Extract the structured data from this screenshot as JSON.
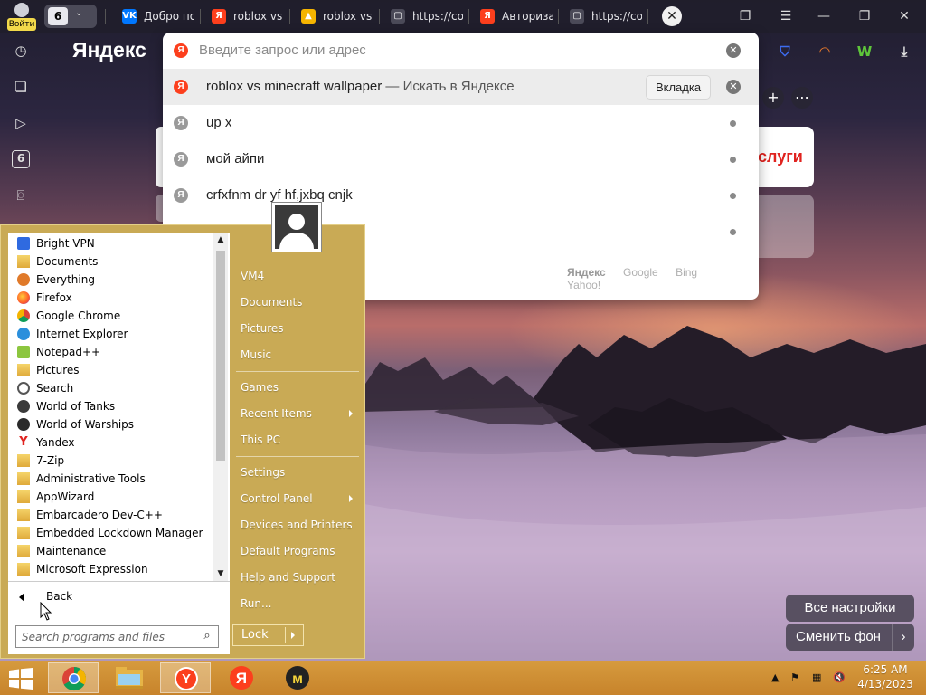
{
  "browser": {
    "profile_label": "Войти",
    "tab_group_count": "6",
    "tabs": [
      {
        "title": "Добро пожаловать",
        "favicon": "vk-icon",
        "color": "#0077ff",
        "glyph": "VK"
      },
      {
        "title": "roblox vs minecraft",
        "favicon": "yandex-icon",
        "color": "#fc3f1d",
        "glyph": "Я"
      },
      {
        "title": "roblox vs minecraft",
        "favicon": "yandex-images-icon",
        "color": "#f5b400",
        "glyph": "▲"
      },
      {
        "title": "https://co",
        "favicon": "page-icon",
        "color": "#4b4a58",
        "glyph": "▢"
      },
      {
        "title": "Авторизация",
        "favicon": "yandex-icon",
        "color": "#fc3f1d",
        "glyph": "Я"
      },
      {
        "title": "https://co",
        "favicon": "page-icon",
        "color": "#4b4a58",
        "glyph": "▢"
      }
    ],
    "logo": "Яндекс",
    "sidebar_badge": "6"
  },
  "omnibox": {
    "placeholder": "Введите запрос или адрес",
    "suggestions": [
      {
        "text": "roblox vs minecraft wallpaper",
        "hint": " — Искать в Яндексе",
        "action": "Вкладка",
        "active": true
      },
      {
        "text": "up x",
        "hint": ""
      },
      {
        "text": "мой айпи",
        "hint": ""
      },
      {
        "text": "crfxfnm dr yf hf,jxbq cnjk",
        "hint": ""
      },
      {
        "text": "",
        "hint": ""
      }
    ],
    "engines": [
      "Яндекс",
      "Google",
      "Bing",
      "Yahoo!"
    ]
  },
  "newtab": {
    "gosuslugi_label": "слуги",
    "all_settings": "Все настройки",
    "change_bg": "Сменить фон"
  },
  "startmenu": {
    "programs": [
      {
        "label": "Bright VPN",
        "icon": "bright-vpn-icon"
      },
      {
        "label": "Documents",
        "icon": "documents-folder-icon"
      },
      {
        "label": "Everything",
        "icon": "everything-icon"
      },
      {
        "label": "Firefox",
        "icon": "firefox-icon"
      },
      {
        "label": "Google Chrome",
        "icon": "chrome-icon"
      },
      {
        "label": "Internet Explorer",
        "icon": "ie-icon"
      },
      {
        "label": "Notepad++",
        "icon": "notepadpp-icon"
      },
      {
        "label": "Pictures",
        "icon": "pictures-folder-icon"
      },
      {
        "label": "Search",
        "icon": "search-icon"
      },
      {
        "label": "World of Tanks",
        "icon": "wot-icon"
      },
      {
        "label": "World of Warships",
        "icon": "wows-icon"
      },
      {
        "label": "Yandex",
        "icon": "yandex-icon"
      },
      {
        "label": "7-Zip",
        "icon": "folder-icon"
      },
      {
        "label": "Administrative Tools",
        "icon": "folder-icon"
      },
      {
        "label": "AppWizard",
        "icon": "folder-icon"
      },
      {
        "label": "Embarcadero Dev-C++",
        "icon": "folder-icon"
      },
      {
        "label": "Embedded Lockdown Manager",
        "icon": "folder-icon"
      },
      {
        "label": "Maintenance",
        "icon": "folder-icon"
      },
      {
        "label": "Microsoft Expression",
        "icon": "folder-icon"
      }
    ],
    "back_label": "Back",
    "search_placeholder": "Search programs and files",
    "right_panel": [
      {
        "label": "VM4",
        "arrow": false
      },
      {
        "label": "Documents",
        "arrow": false
      },
      {
        "label": "Pictures",
        "arrow": false
      },
      {
        "label": "Music",
        "arrow": false
      },
      {
        "label": "Games",
        "arrow": false
      },
      {
        "label": "Recent Items",
        "arrow": true
      },
      {
        "label": "This PC",
        "arrow": false
      },
      {
        "label": "Settings",
        "arrow": false
      },
      {
        "label": "Control Panel",
        "arrow": true
      },
      {
        "label": "Devices and Printers",
        "arrow": false
      },
      {
        "label": "Default Programs",
        "arrow": false
      },
      {
        "label": "Help and Support",
        "arrow": false
      },
      {
        "label": "Run...",
        "arrow": false
      }
    ],
    "lock_label": "Lock"
  },
  "taskbar": {
    "apps": [
      {
        "name": "chrome-taskbar-icon",
        "active": true
      },
      {
        "name": "explorer-taskbar-icon",
        "active": false
      },
      {
        "name": "yandex-browser-taskbar-icon",
        "active": true
      },
      {
        "name": "yandex-taskbar-icon",
        "active": false
      },
      {
        "name": "yandex-music-taskbar-icon",
        "active": false
      }
    ],
    "time": "6:25 AM",
    "date": "4/13/2023"
  }
}
